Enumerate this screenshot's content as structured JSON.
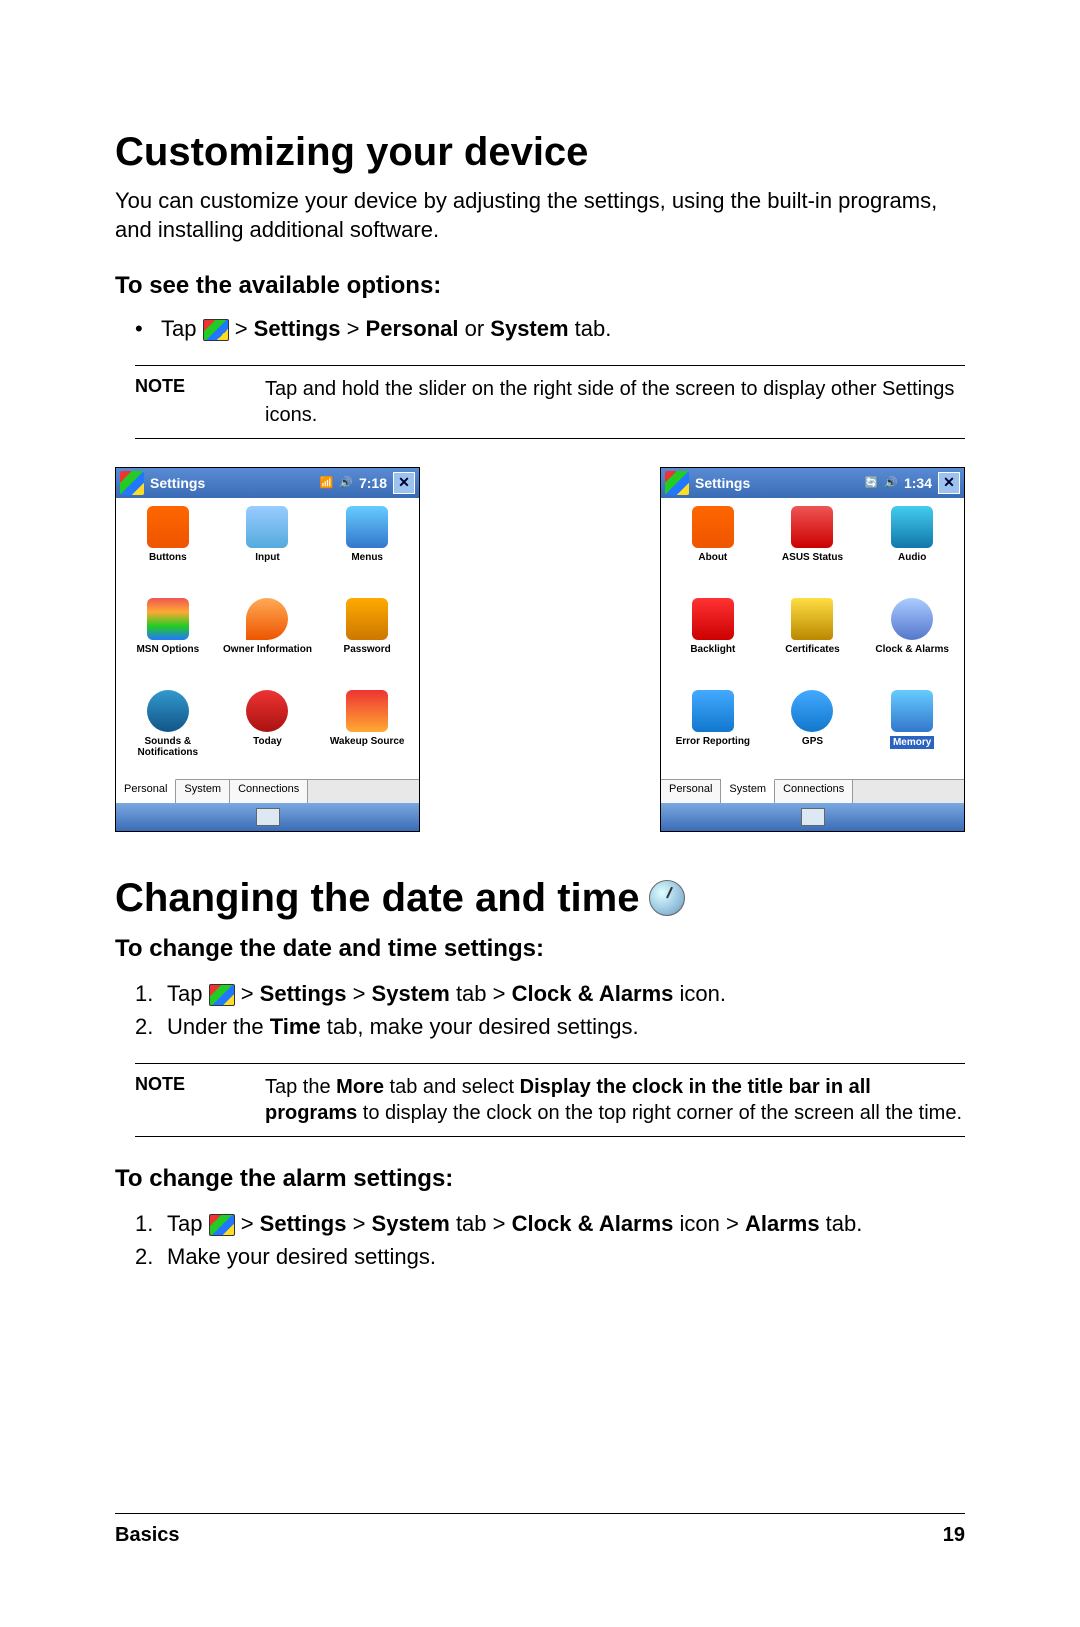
{
  "h1": "Customizing your device",
  "intro": "You can customize your device by adjusting the settings, using the built-in programs, and installing additional software.",
  "sub1": "To see the available options:",
  "bullet1_a": "Tap ",
  "bullet1_b": " > ",
  "bullet1_c": "Settings",
  "bullet1_d": " > ",
  "bullet1_e": "Personal",
  "bullet1_f": " or ",
  "bullet1_g": "System",
  "bullet1_h": " tab.",
  "note1_label": "NOTE",
  "note1_text": "Tap and hold the slider on the right side of the screen to display other Settings icons.",
  "screen1": {
    "title": "Settings",
    "time": "7:18",
    "items": [
      "Buttons",
      "Input",
      "Menus",
      "MSN Options",
      "Owner Information",
      "Password",
      "Sounds & Notifications",
      "Today",
      "Wakeup Source"
    ],
    "tabs": [
      "Personal",
      "System",
      "Connections"
    ],
    "active_tab": 0
  },
  "screen2": {
    "title": "Settings",
    "time": "1:34",
    "items": [
      "About",
      "ASUS Status",
      "Audio",
      "Backlight",
      "Certificates",
      "Clock & Alarms",
      "Error Reporting",
      "GPS",
      "Memory",
      "",
      "",
      ""
    ],
    "selected": 8,
    "tabs": [
      "Personal",
      "System",
      "Connections"
    ],
    "active_tab": 1
  },
  "h2": "Changing the date and time",
  "sub2": "To change the date and time settings:",
  "step2_1_a": "Tap ",
  "step2_1_b": " > ",
  "step2_1_c": "Settings",
  "step2_1_d": " > ",
  "step2_1_e": "System",
  "step2_1_f": " tab > ",
  "step2_1_g": "Clock & Alarms",
  "step2_1_h": " icon.",
  "step2_2_a": "Under the ",
  "step2_2_b": "Time",
  "step2_2_c": " tab, make your desired settings.",
  "note2_label": "NOTE",
  "note2_a": "Tap the ",
  "note2_b": "More",
  "note2_c": " tab and select ",
  "note2_d": "Display the clock in the title bar in all programs",
  "note2_e": " to display the clock on the top right corner of the screen all the time.",
  "sub3": "To change the alarm settings:",
  "step3_1_a": "Tap ",
  "step3_1_b": " > ",
  "step3_1_c": "Settings",
  "step3_1_d": " > ",
  "step3_1_e": "System",
  "step3_1_f": " tab > ",
  "step3_1_g": "Clock & Alarms",
  "step3_1_h": " icon > ",
  "step3_1_i": "Alarms",
  "step3_1_j": " tab.",
  "step3_2": "Make your desired settings.",
  "footer_left": "Basics",
  "footer_right": "19"
}
